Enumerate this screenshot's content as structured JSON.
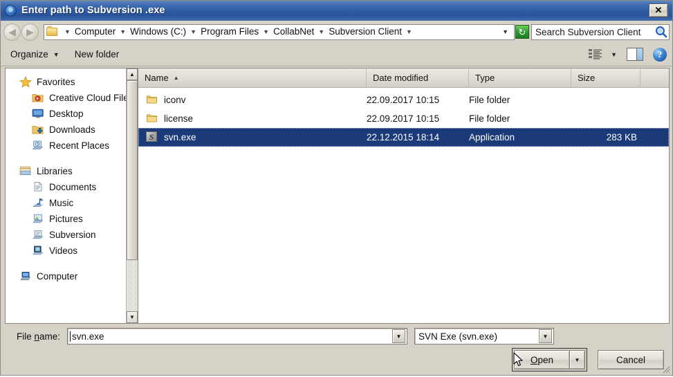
{
  "window": {
    "title": "Enter path to Subversion .exe",
    "title_icon": "subversion-logo-icon",
    "close_label": "✕"
  },
  "address_bar": {
    "back_icon": "back-arrow-icon",
    "forward_icon": "forward-arrow-icon",
    "folder_icon": "folder-icon",
    "crumbs": [
      "Computer",
      "Windows (C:)",
      "Program Files",
      "CollabNet",
      "Subversion Client"
    ],
    "separator": "▼",
    "history_caret": "▼",
    "refresh_icon": "↻",
    "refresh_label": "refresh-button"
  },
  "search": {
    "placeholder": "Search Subversion Client",
    "value": "Search Subversion Client",
    "icon": "magnifier-icon"
  },
  "toolbar": {
    "organize_label": "Organize",
    "organize_caret": "▼",
    "new_folder_label": "New folder",
    "view_icon": "view-options-icon",
    "view_caret": "▼",
    "preview_pane_icon": "preview-pane-icon",
    "help_icon": "?"
  },
  "nav_pane": {
    "sections": [
      {
        "header": {
          "label": "Favorites",
          "icon": "star-icon"
        },
        "items": [
          {
            "label": "Creative Cloud Files",
            "icon": "creative-cloud-folder-icon"
          },
          {
            "label": "Desktop",
            "icon": "desktop-icon"
          },
          {
            "label": "Downloads",
            "icon": "downloads-folder-icon"
          },
          {
            "label": "Recent Places",
            "icon": "recent-places-icon"
          }
        ]
      },
      {
        "header": {
          "label": "Libraries",
          "icon": "libraries-icon"
        },
        "items": [
          {
            "label": "Documents",
            "icon": "documents-library-icon"
          },
          {
            "label": "Music",
            "icon": "music-library-icon"
          },
          {
            "label": "Pictures",
            "icon": "pictures-library-icon"
          },
          {
            "label": "Subversion",
            "icon": "subversion-library-icon"
          },
          {
            "label": "Videos",
            "icon": "videos-library-icon"
          }
        ]
      },
      {
        "header": {
          "label": "Computer",
          "icon": "computer-icon"
        },
        "items": []
      }
    ],
    "scrollbar": {
      "up_arrow": "▲",
      "down_arrow": "▼"
    }
  },
  "file_list": {
    "columns": [
      {
        "label": "Name",
        "sort": "▲"
      },
      {
        "label": "Date modified",
        "sort": ""
      },
      {
        "label": "Type",
        "sort": ""
      },
      {
        "label": "Size",
        "sort": ""
      }
    ],
    "rows": [
      {
        "name": "iconv",
        "date": "22.09.2017 10:15",
        "type": "File folder",
        "size": "",
        "icon": "folder-icon",
        "selected": false
      },
      {
        "name": "license",
        "date": "22.09.2017 10:15",
        "type": "File folder",
        "size": "",
        "icon": "folder-icon",
        "selected": false
      },
      {
        "name": "svn.exe",
        "date": "22.12.2015 18:14",
        "type": "Application",
        "size": "283 KB",
        "icon": "svn-exe-icon",
        "selected": true
      }
    ]
  },
  "form": {
    "file_name_label_pre": "File ",
    "file_name_label_accel": "n",
    "file_name_label_post": "ame:",
    "file_name_value": "svn.exe",
    "file_name_dropdown_icon": "▼",
    "file_type_value": "SVN Exe (svn.exe)",
    "file_type_dropdown_icon": "▼",
    "open_label_pre": "",
    "open_label_accel": "O",
    "open_label_post": "pen",
    "open_split_icon": "▼",
    "cancel_label": "Cancel"
  },
  "colors": {
    "title_bar": "#2e5ba4",
    "selection": "#1b3a7a",
    "dialog_face": "#d6d2c8",
    "refresh_green": "#2f9b33"
  }
}
